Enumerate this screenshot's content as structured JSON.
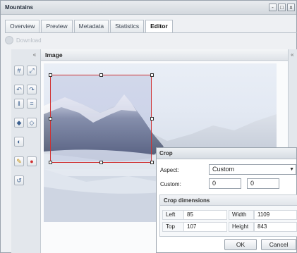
{
  "window": {
    "title": "Mountains",
    "controls": [
      "-",
      "□",
      "x"
    ]
  },
  "tabs": [
    {
      "label": "Overview",
      "active": false
    },
    {
      "label": "Preview",
      "active": false
    },
    {
      "label": "Metadata",
      "active": false
    },
    {
      "label": "Statistics",
      "active": false
    },
    {
      "label": "Editor",
      "active": true
    }
  ],
  "toolbar": {
    "disabled_label": "Download"
  },
  "image_panel": {
    "title": "Image"
  },
  "tools": [
    {
      "icon": "crop-icon",
      "glyph": "#"
    },
    {
      "icon": "resize-icon",
      "glyph": "⤢"
    },
    {
      "icon": "rotate-left-icon",
      "glyph": "↶"
    },
    {
      "icon": "rotate-right-icon",
      "glyph": "↷"
    },
    {
      "icon": "flip-vertical-icon",
      "glyph": "‖"
    },
    {
      "icon": "flip-horizontal-icon",
      "glyph": "="
    },
    {
      "icon": "brightness-icon",
      "glyph": "◆"
    },
    {
      "icon": "contrast-icon",
      "glyph": "◇"
    },
    {
      "icon": "levels-icon",
      "glyph": "◐"
    },
    {
      "icon": "sharpen-icon",
      "glyph": "✎"
    },
    {
      "icon": "redeye-icon",
      "glyph": "●"
    },
    {
      "icon": "undo-icon",
      "glyph": "↺"
    }
  ],
  "crop_dialog": {
    "title": "Crop",
    "aspect_label": "Aspect:",
    "aspect_value": "Custom",
    "custom_label": "Custom:",
    "custom_w": "0",
    "custom_h": "0",
    "dimensions_title": "Crop dimensions",
    "left_label": "Left",
    "left_value": "85",
    "width_label": "Width",
    "width_value": "1109",
    "top_label": "Top",
    "top_value": "107",
    "height_label": "Height",
    "height_value": "843",
    "ok_label": "OK",
    "cancel_label": "Cancel"
  },
  "colors": {
    "crop_border": "#d03030",
    "selection_tint": "#6e78be"
  }
}
